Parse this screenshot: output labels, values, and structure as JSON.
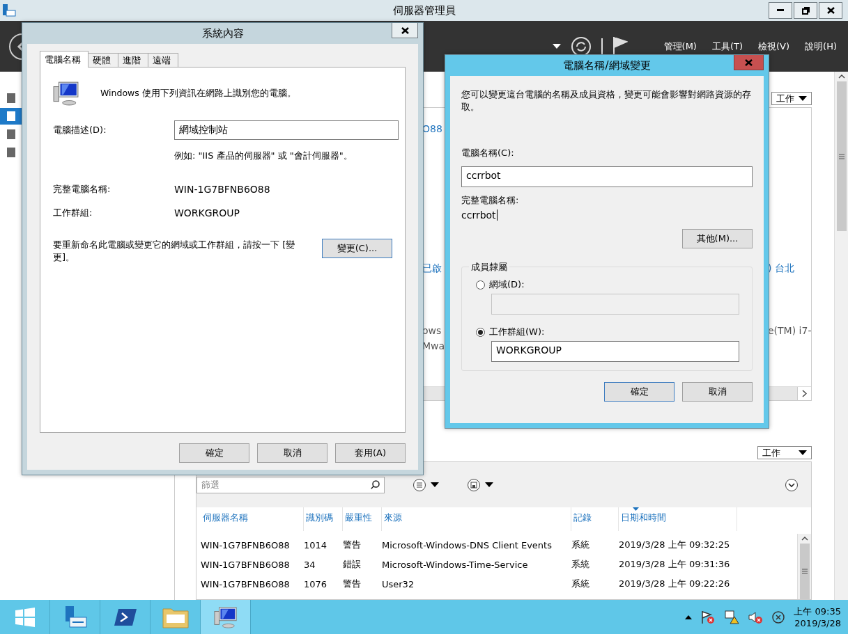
{
  "app": {
    "title": "伺服器管理員",
    "menu": [
      "管理(M)",
      "工具(T)",
      "檢視(V)",
      "說明(H)"
    ]
  },
  "sidebar": {
    "items": [
      {
        "selected": false
      },
      {
        "selected": true
      },
      {
        "selected": false
      },
      {
        "selected": false
      }
    ]
  },
  "properties_panel": {
    "tasks_label": "工作",
    "rows": [
      {
        "column_1": "O88"
      },
      {
        "column_1": "已啟",
        "column_2": ") 台北"
      },
      {
        "column_1": "ows",
        "column_2": "e(TM) i7-"
      },
      {
        "column_1": "Mwa"
      }
    ]
  },
  "events_panel": {
    "tasks_label": "工作",
    "filter_placeholder": "篩選",
    "columns": [
      {
        "label": "伺服器名稱",
        "sorted": false
      },
      {
        "label": "識別碼",
        "sorted": false
      },
      {
        "label": "嚴重性",
        "sorted": false
      },
      {
        "label": "來源",
        "sorted": false
      },
      {
        "label": "記錄",
        "sorted": false
      },
      {
        "label": "日期和時間",
        "sorted": true
      }
    ],
    "rows": [
      [
        "WIN-1G7BFNB6O88",
        "1014",
        "警告",
        "Microsoft-Windows-DNS Client Events",
        "系統",
        "2019/3/28 上午 09:32:25"
      ],
      [
        "WIN-1G7BFNB6O88",
        "34",
        "錯誤",
        "Microsoft-Windows-Time-Service",
        "系統",
        "2019/3/28 上午 09:31:36"
      ],
      [
        "WIN-1G7BFNB6O88",
        "1076",
        "警告",
        "User32",
        "系統",
        "2019/3/28 上午 09:22:26"
      ]
    ]
  },
  "system_properties": {
    "title": "系統內容",
    "tabs": [
      {
        "label": "電腦名稱",
        "selected": true
      },
      {
        "label": "硬體",
        "selected": false
      },
      {
        "label": "進階",
        "selected": false
      },
      {
        "label": "遠端",
        "selected": false
      }
    ],
    "intro": "Windows 使用下列資訊在網路上識別您的電腦。",
    "description_label": "電腦描述(D):",
    "description_value": "網域控制站",
    "example": "例如: \"IIS 產品的伺服器\" 或 \"會計伺服器\"。",
    "full_name_label": "完整電腦名稱:",
    "full_name": "WIN-1G7BFNB6O88",
    "workgroup_label": "工作群組:",
    "workgroup": "WORKGROUP",
    "rename_text": "要重新命名此電腦或變更它的網域或工作群組，請按一下 [變更]。",
    "change_button": "變更(C)...",
    "buttons": [
      {
        "label": "確定",
        "default": false
      },
      {
        "label": "取消",
        "default": false
      },
      {
        "label": "套用(A)",
        "default": false
      }
    ]
  },
  "name_change_dialog": {
    "title": "電腦名稱/網域變更",
    "intro": "您可以變更這台電腦的名稱及成員資格，變更可能會影響對網路資源的存取。",
    "name_label": "電腦名稱(C):",
    "name_value": "ccrrbot",
    "full_name_label": "完整電腦名稱:",
    "full_name": "ccrrbot",
    "more_button": "其他(M)...",
    "membership": {
      "legend": "成員隸屬",
      "options": [
        {
          "label": "網域(D):",
          "selected": false
        },
        {
          "label": "工作群組(W):",
          "selected": true,
          "value": "WORKGROUP"
        }
      ]
    },
    "buttons": [
      {
        "label": "確定",
        "default": true
      },
      {
        "label": "取消",
        "default": false
      }
    ]
  },
  "taskbar": {
    "time": "上午 09:35",
    "date": "2019/3/28"
  }
}
